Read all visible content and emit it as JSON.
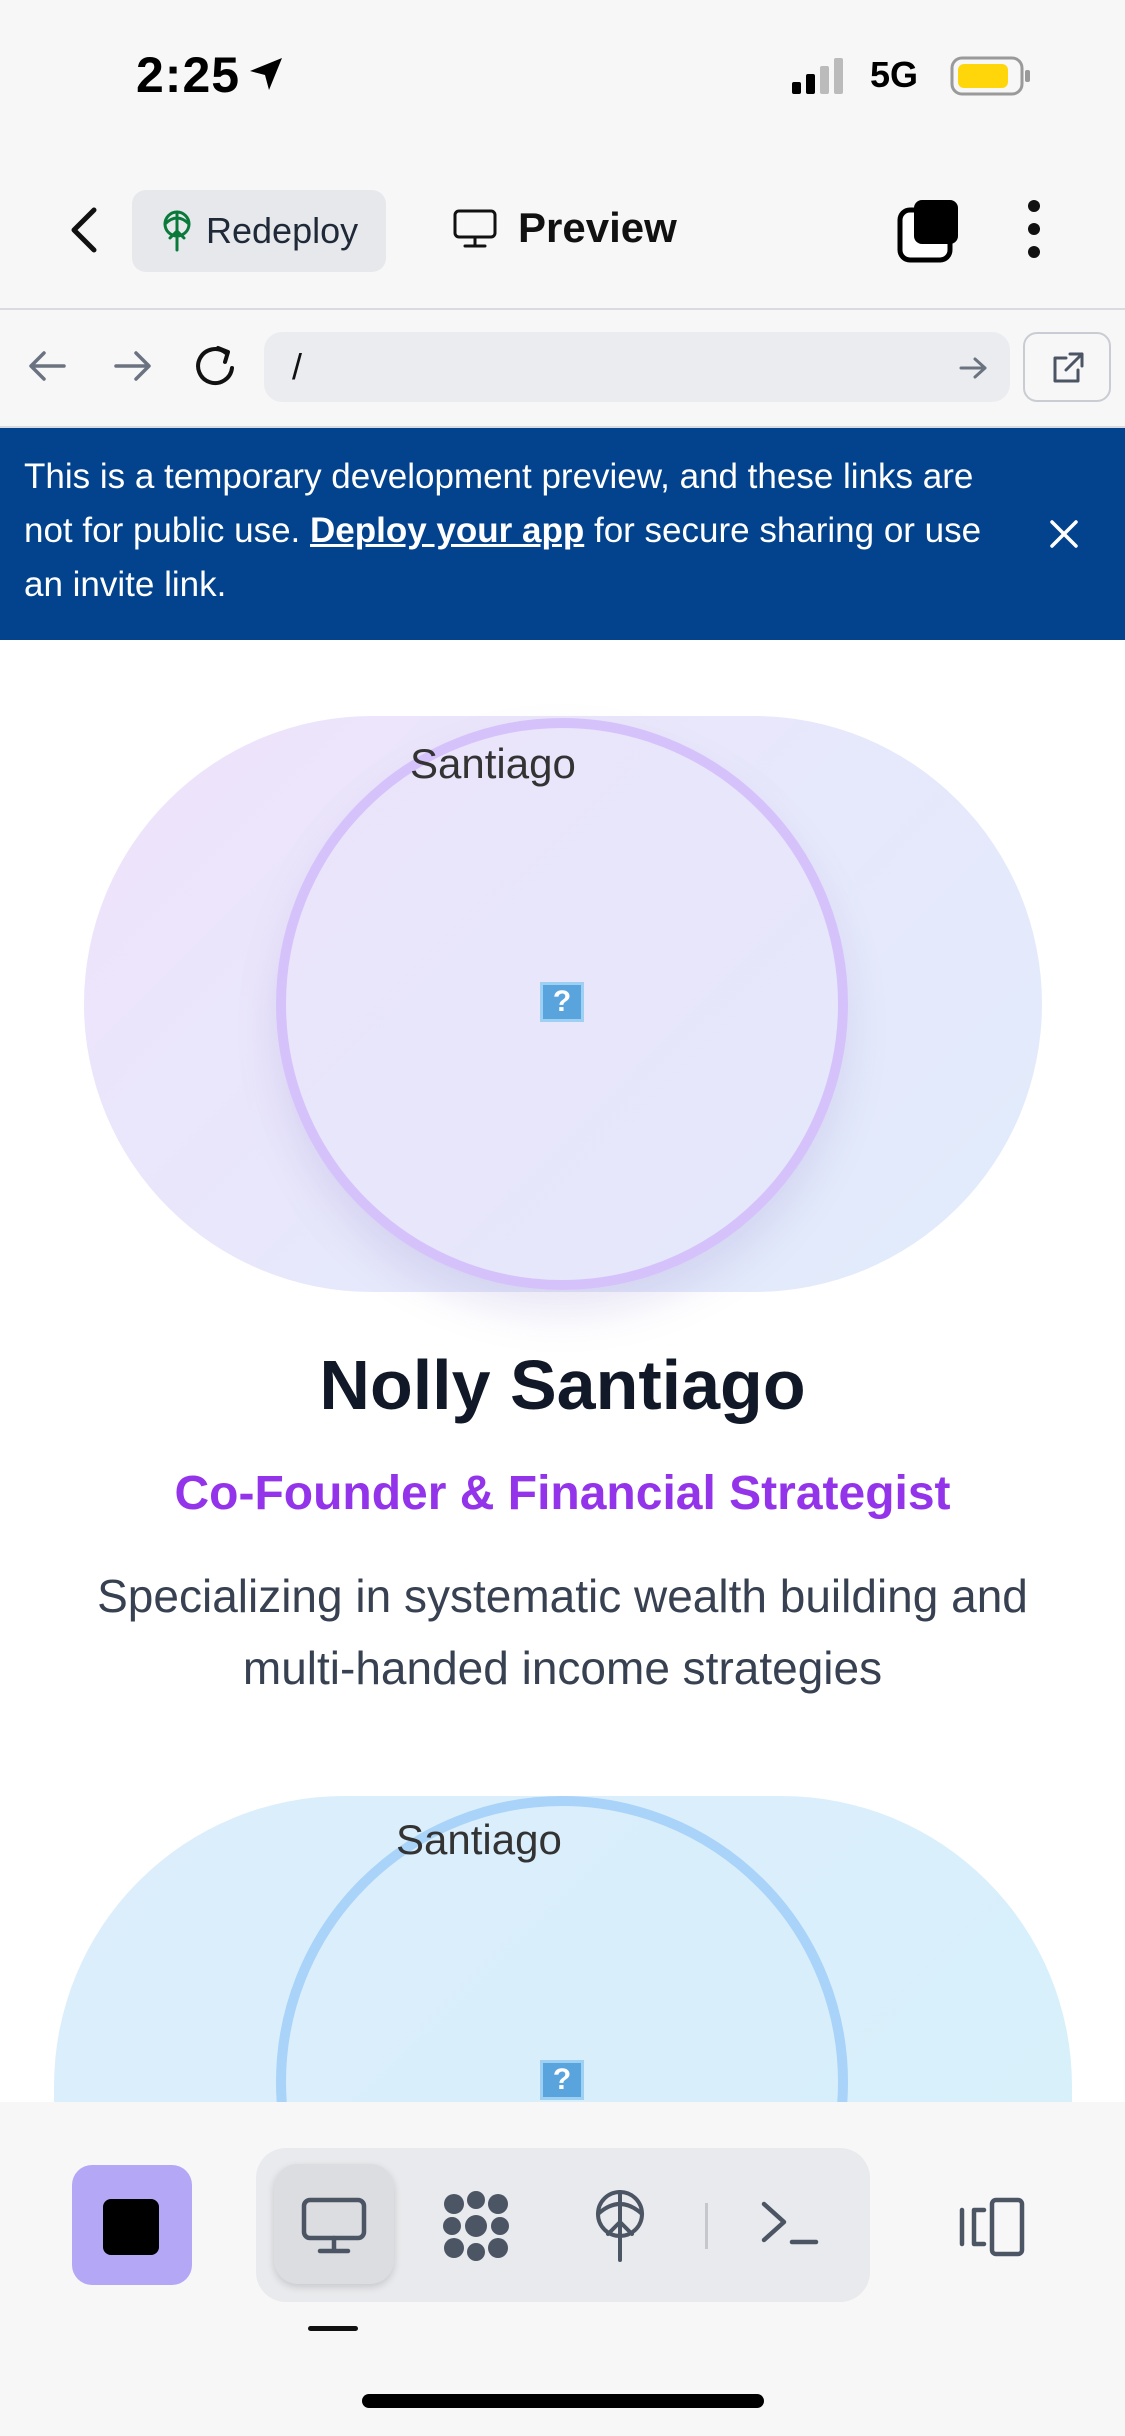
{
  "status_bar": {
    "time": "2:25",
    "network": "5G"
  },
  "header": {
    "redeploy_label": "Redeploy",
    "preview_label": "Preview"
  },
  "url_bar": {
    "path": "/"
  },
  "banner": {
    "text_before": "This is a temporary development preview, and these links are not for public use.",
    "link_text": "Deploy your app",
    "text_after": "for secure sharing or use an invite link."
  },
  "profiles": [
    {
      "image_alt": "Santiago",
      "name": "Nolly Santiago",
      "role": "Co-Founder & Financial Strategist",
      "bio": "Specializing in systematic wealth building and multi-handed income strategies"
    },
    {
      "image_alt": "Santiago"
    }
  ],
  "broken_image_glyph": "?",
  "colors": {
    "banner": "#03428c",
    "role_accent": "#9333ea",
    "stop_button": "#b4a7f6"
  },
  "icons": [
    "location-arrow-icon",
    "cellular-signal-icon",
    "battery-icon",
    "back-chevron-icon",
    "redeploy-icon",
    "monitor-icon",
    "tabs-icon",
    "more-icon",
    "nav-back-icon",
    "nav-forward-icon",
    "reload-icon",
    "go-arrow-icon",
    "external-link-icon",
    "close-icon",
    "stop-icon",
    "desktop-icon",
    "agent-icon",
    "deploy-icon",
    "terminal-icon",
    "layout-toggle-icon"
  ]
}
